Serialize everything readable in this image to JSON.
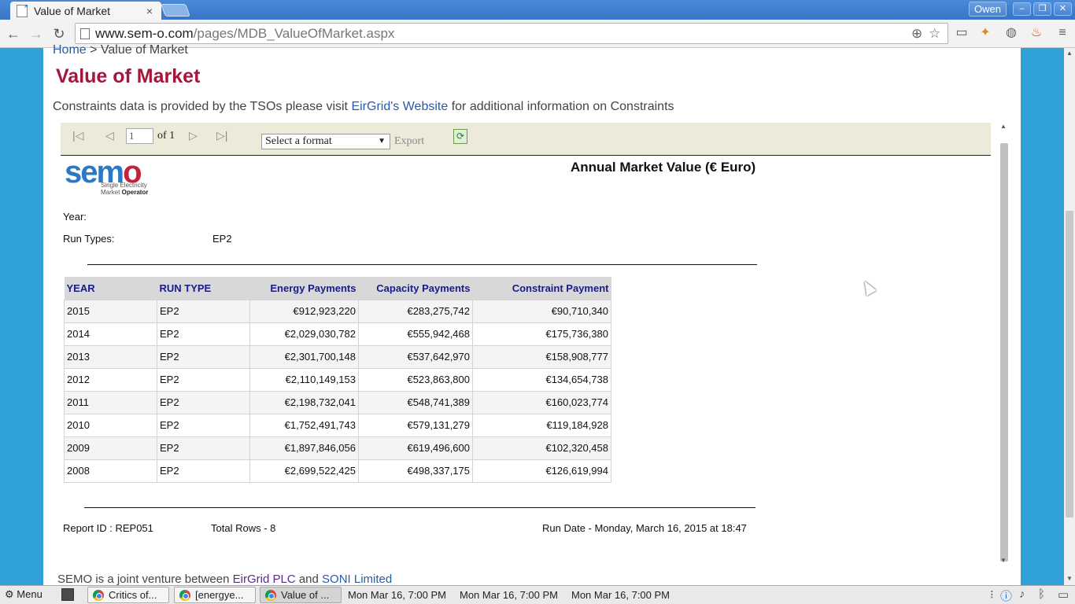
{
  "browser": {
    "tab_title": "Value of Market",
    "tab_close": "×",
    "user": "Owen",
    "url_host": "www.sem-o.com",
    "url_path": "/pages/MDB_ValueOfMarket.aspx",
    "win_minimize": "–",
    "win_restore": "❐",
    "win_close": "✕"
  },
  "page": {
    "breadcrumb_home": "Home",
    "breadcrumb_sep": " > ",
    "breadcrumb_current": "Value of Market",
    "title": "Value of Market",
    "info_prefix": "Constraints data is provided by the TSOs please visit ",
    "info_link": "EirGrid's Website",
    "info_suffix": " for additional information on Constraints"
  },
  "report_toolbar": {
    "page_number": "1",
    "of_text": "of  1",
    "format_select": "Select a format",
    "export": "Export"
  },
  "report": {
    "logo_text_1": "sem",
    "logo_text_2": "o",
    "logo_sub_1": "Single Electricity",
    "logo_sub_2": "Market ",
    "logo_sub_3": "Operator",
    "title": "Annual Market Value (€ Euro)",
    "year_label": "Year:",
    "run_types_label": "Run Types:",
    "run_types_value": "EP2",
    "columns": [
      "YEAR",
      "RUN TYPE",
      "Energy Payments",
      "Capacity Payments",
      "Constraint Payment"
    ],
    "rows": [
      [
        "2015",
        "EP2",
        "€912,923,220",
        "€283,275,742",
        "€90,710,340"
      ],
      [
        "2014",
        "EP2",
        "€2,029,030,782",
        "€555,942,468",
        "€175,736,380"
      ],
      [
        "2013",
        "EP2",
        "€2,301,700,148",
        "€537,642,970",
        "€158,908,777"
      ],
      [
        "2012",
        "EP2",
        "€2,110,149,153",
        "€523,863,800",
        "€134,654,738"
      ],
      [
        "2011",
        "EP2",
        "€2,198,732,041",
        "€548,741,389",
        "€160,023,774"
      ],
      [
        "2010",
        "EP2",
        "€1,752,491,743",
        "€579,131,279",
        "€119,184,928"
      ],
      [
        "2009",
        "EP2",
        "€1,897,846,056",
        "€619,496,600",
        "€102,320,458"
      ],
      [
        "2008",
        "EP2",
        "€2,699,522,425",
        "€498,337,175",
        "€126,619,994"
      ]
    ],
    "report_id": "Report ID : REP051",
    "total_rows": "Total Rows - 8",
    "run_date": "Run Date - Monday, March 16, 2015 at 18:47"
  },
  "footer": {
    "prefix": "SEMO is a joint venture between ",
    "link1": "EirGrid PLC",
    "and": " and ",
    "link2": "SONI Limited"
  },
  "taskbar": {
    "menu": "Menu",
    "items": [
      "Critics of...",
      "[energye...",
      "Value of ..."
    ],
    "clocks": [
      "Mon Mar 16,  7:00 PM",
      "Mon Mar 16,  7:00 PM",
      "Mon Mar 16,  7:00 PM"
    ]
  },
  "colors": {
    "title_red": "#a4163c",
    "link_blue": "#2a5aa8",
    "header_navy": "#1a1a8a",
    "report_toolbar_bg": "#ecead9"
  }
}
